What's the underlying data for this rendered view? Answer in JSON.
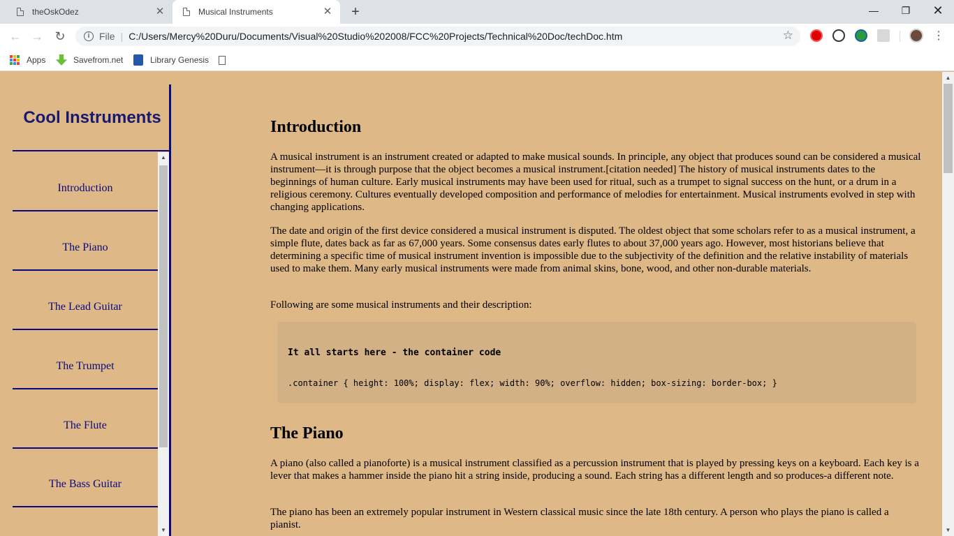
{
  "browser": {
    "tabs": [
      {
        "title": "theOskOdez",
        "close": "✕"
      },
      {
        "title": "Musical Instruments",
        "close": "✕"
      }
    ],
    "new_tab": "+",
    "window_controls": {
      "minimize": "—",
      "maximize": "❐",
      "close": "✕"
    },
    "nav": {
      "back": "←",
      "forward": "→",
      "reload": "↻"
    },
    "omnibox": {
      "scheme_label": "File",
      "separator": "|",
      "url": "C:/Users/Mercy%20Duru/Documents/Visual%20Studio%202008/FCC%20Projects/Technical%20Doc/techDoc.htm",
      "info_glyph": "i",
      "star": "☆"
    },
    "menu": "⋮",
    "bookmarks": [
      {
        "label": "Apps",
        "icon": "apps-grid-icon"
      },
      {
        "label": "Savefrom.net",
        "icon": "download-arrow-icon"
      },
      {
        "label": "Library Genesis",
        "icon": "library-icon"
      }
    ],
    "apps_grid_colors": [
      "#ea4335",
      "#fbbc04",
      "#34a853",
      "#4285f4",
      "#ea4335",
      "#fbbc04",
      "#34a853",
      "#4285f4",
      "#ea4335"
    ]
  },
  "page": {
    "background": "#deb887",
    "nav": {
      "title": "Cool Instruments",
      "items": [
        {
          "label": "Introduction"
        },
        {
          "label": "The Piano"
        },
        {
          "label": "The Lead Guitar"
        },
        {
          "label": "The Trumpet"
        },
        {
          "label": "The Flute"
        },
        {
          "label": "The Bass Guitar"
        }
      ],
      "color": "#0a0a80"
    },
    "scroll": {
      "up": "▲",
      "down": "▼"
    },
    "sections": {
      "introduction": {
        "heading": "Introduction",
        "paragraphs": [
          "A musical instrument is an instrument created or adapted to make musical sounds. In principle, any object that produces sound can be considered a musical instrument—it is through purpose that the object becomes a musical instrument.[citation needed] The history of musical instruments dates to the beginnings of human culture. Early musical instruments may have been used for ritual, such as a trumpet to signal success on the hunt, or a drum in a religious ceremony. Cultures eventually developed composition and performance of melodies for entertainment. Musical instruments evolved in step with changing applications.",
          "The date and origin of the first device considered a musical instrument is disputed. The oldest object that some scholars refer to as a musical instrument, a simple flute, dates back as far as 67,000 years. Some consensus dates early flutes to about 37,000 years ago. However, most historians believe that determining a specific time of musical instrument invention is impossible due to the subjectivity of the definition and the relative instability of materials used to make them. Many early musical instruments were made from animal skins, bone, wood, and other non-durable materials.",
          "Following are some musical instruments and their description:"
        ],
        "code": {
          "title": "It all starts here - the container code",
          "line": ".container { height: 100%; display: flex; width: 90%; overflow: hidden; box-sizing: border-box; }"
        }
      },
      "piano": {
        "heading": "The Piano",
        "paragraphs": [
          "A piano (also called a pianoforte) is a musical instrument classified as a percussion instrument that is played by pressing keys on a keyboard. Each key is a lever that makes a hammer inside the piano hit a string inside, producing a sound. Each string has a different length and so produces-a different note.",
          "The piano has been an extremely popular instrument in Western classical music since the late 18th century. A person who plays the piano is called a pianist."
        ]
      }
    }
  }
}
